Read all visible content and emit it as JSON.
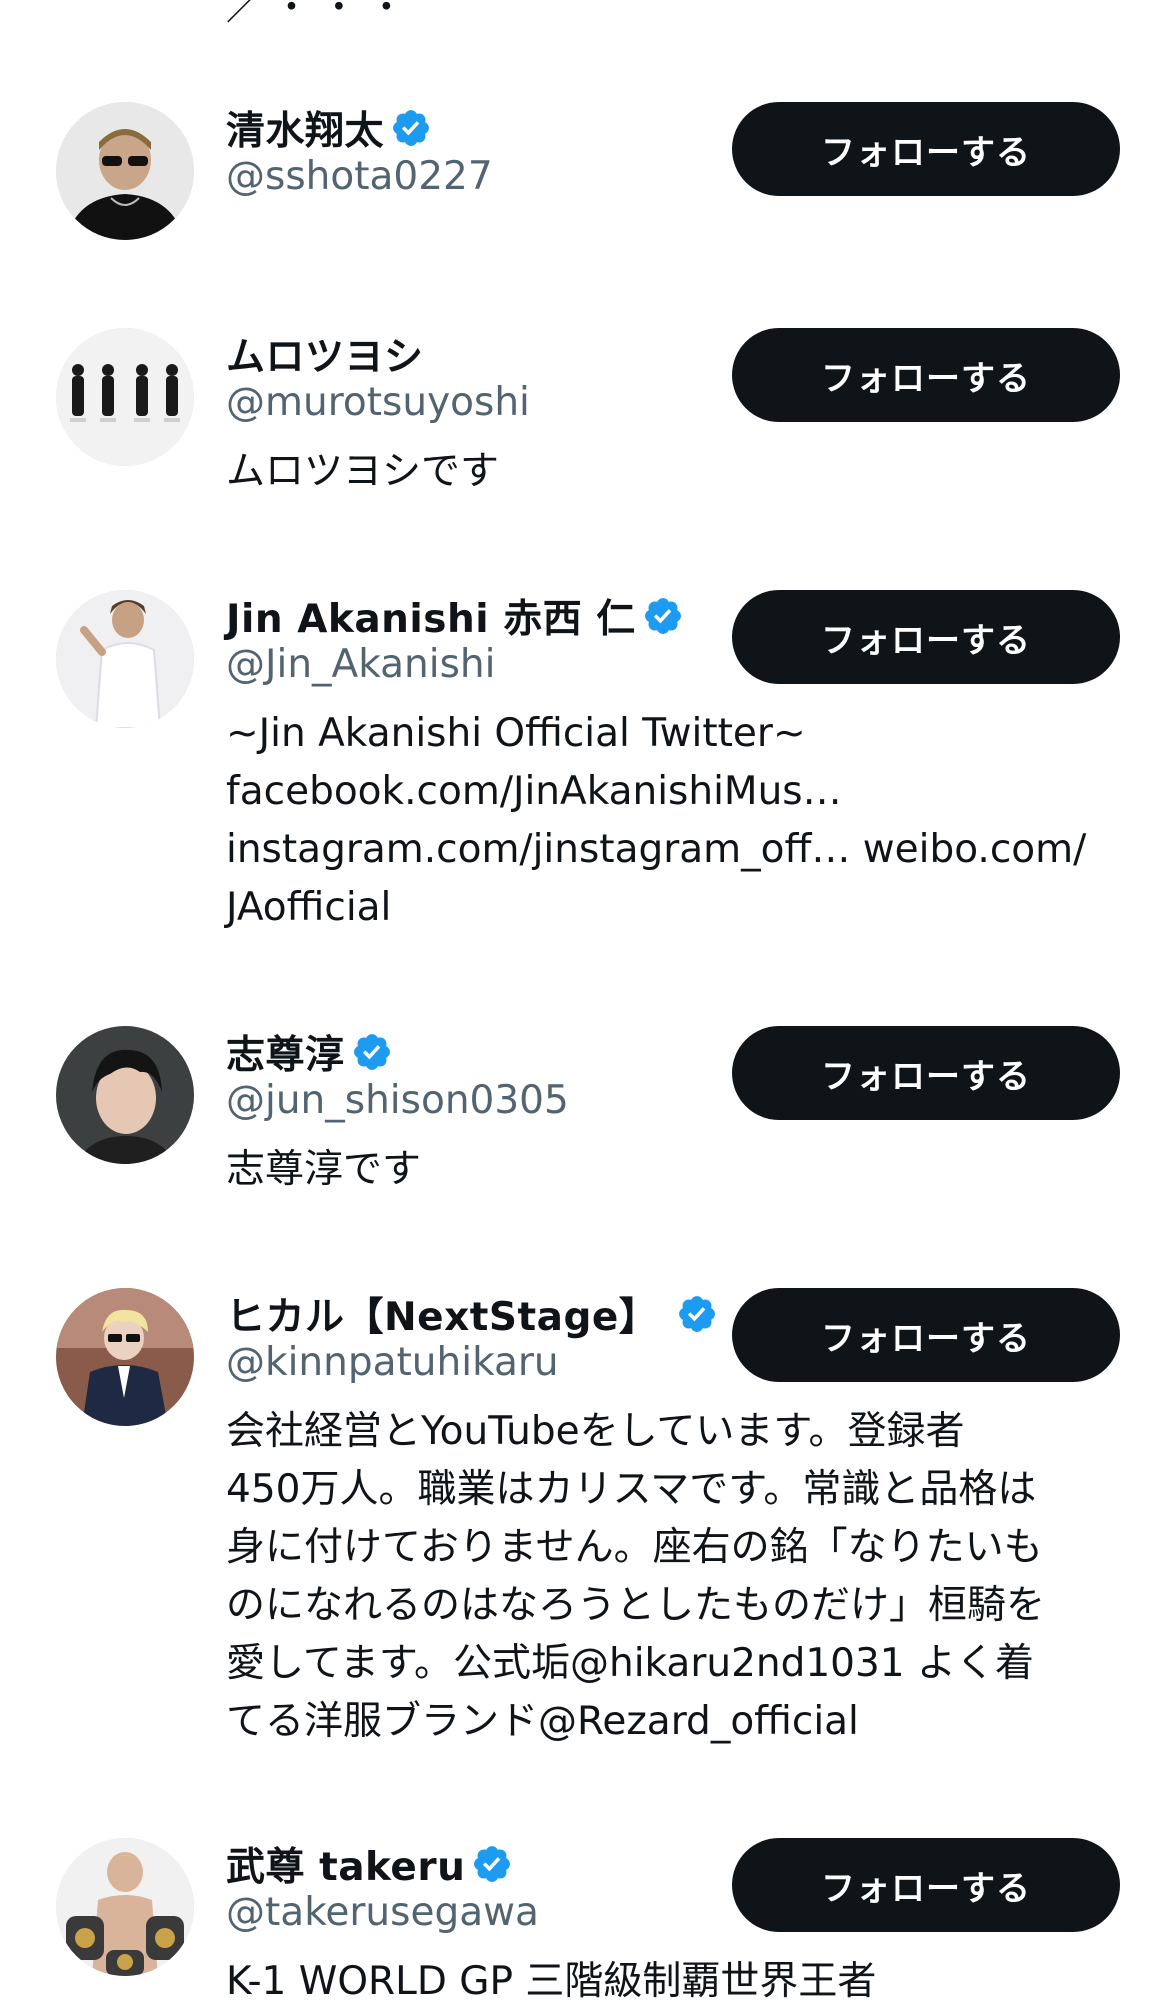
{
  "top_fragment": "／ ・ ・ ・",
  "follow_label": "フォローする",
  "accent_color": "#1d9bf0",
  "button_color": "#0f1419",
  "users": [
    {
      "display_name": "清水翔太",
      "verified": true,
      "handle": "@sshota0227",
      "bio": ""
    },
    {
      "display_name": "ムロツヨシ",
      "verified": false,
      "handle": "@murotsuyoshi",
      "bio": "ムロツヨシです"
    },
    {
      "display_name": "Jin Akanishi  赤西 仁",
      "verified": true,
      "handle": "@Jin_Akanishi",
      "bio": "~Jin Akanishi Official Twitter~\nfacebook.com/JinAkanishiMus…\ninstagram.com/jinstagram_off… weibo.com/\nJAofficial"
    },
    {
      "display_name": "志尊淳",
      "verified": true,
      "handle": "@jun_shison0305",
      "bio": "志尊淳です"
    },
    {
      "display_name": "ヒカル【NextStage】",
      "verified": true,
      "handle": "@kinnpatuhikaru",
      "bio": "会社経営とYouTubeをしています。登録者\n450万人。職業はカリスマです。常識と品格は\n身に付けておりません。座右の銘「なりたいも\nのになれるのはなろうとしたものだけ」桓騎を\n愛してます。公式垢@hikaru2nd1031 よく着\nてる洋服ブランド@Rezard_official"
    },
    {
      "display_name": "武尊 takeru",
      "verified": true,
      "handle": "@takerusegawa",
      "bio": "K-1 WORLD GP 三階級制覇世界王者"
    }
  ]
}
